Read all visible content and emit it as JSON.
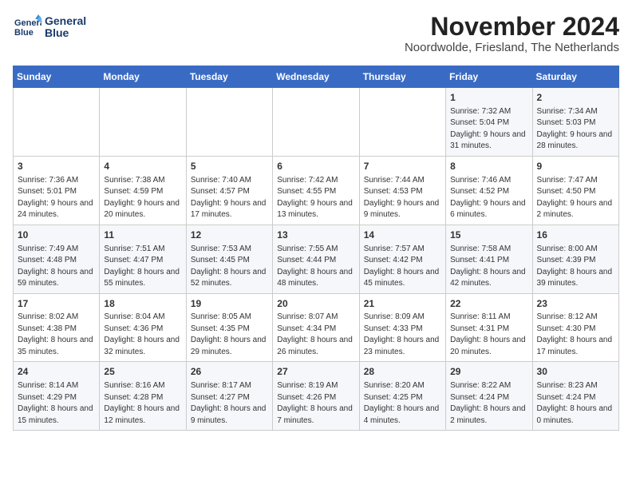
{
  "header": {
    "logo_line1": "General",
    "logo_line2": "Blue",
    "month_title": "November 2024",
    "location": "Noordwolde, Friesland, The Netherlands"
  },
  "weekdays": [
    "Sunday",
    "Monday",
    "Tuesday",
    "Wednesday",
    "Thursday",
    "Friday",
    "Saturday"
  ],
  "weeks": [
    [
      {
        "day": "",
        "info": ""
      },
      {
        "day": "",
        "info": ""
      },
      {
        "day": "",
        "info": ""
      },
      {
        "day": "",
        "info": ""
      },
      {
        "day": "",
        "info": ""
      },
      {
        "day": "1",
        "info": "Sunrise: 7:32 AM\nSunset: 5:04 PM\nDaylight: 9 hours and 31 minutes."
      },
      {
        "day": "2",
        "info": "Sunrise: 7:34 AM\nSunset: 5:03 PM\nDaylight: 9 hours and 28 minutes."
      }
    ],
    [
      {
        "day": "3",
        "info": "Sunrise: 7:36 AM\nSunset: 5:01 PM\nDaylight: 9 hours and 24 minutes."
      },
      {
        "day": "4",
        "info": "Sunrise: 7:38 AM\nSunset: 4:59 PM\nDaylight: 9 hours and 20 minutes."
      },
      {
        "day": "5",
        "info": "Sunrise: 7:40 AM\nSunset: 4:57 PM\nDaylight: 9 hours and 17 minutes."
      },
      {
        "day": "6",
        "info": "Sunrise: 7:42 AM\nSunset: 4:55 PM\nDaylight: 9 hours and 13 minutes."
      },
      {
        "day": "7",
        "info": "Sunrise: 7:44 AM\nSunset: 4:53 PM\nDaylight: 9 hours and 9 minutes."
      },
      {
        "day": "8",
        "info": "Sunrise: 7:46 AM\nSunset: 4:52 PM\nDaylight: 9 hours and 6 minutes."
      },
      {
        "day": "9",
        "info": "Sunrise: 7:47 AM\nSunset: 4:50 PM\nDaylight: 9 hours and 2 minutes."
      }
    ],
    [
      {
        "day": "10",
        "info": "Sunrise: 7:49 AM\nSunset: 4:48 PM\nDaylight: 8 hours and 59 minutes."
      },
      {
        "day": "11",
        "info": "Sunrise: 7:51 AM\nSunset: 4:47 PM\nDaylight: 8 hours and 55 minutes."
      },
      {
        "day": "12",
        "info": "Sunrise: 7:53 AM\nSunset: 4:45 PM\nDaylight: 8 hours and 52 minutes."
      },
      {
        "day": "13",
        "info": "Sunrise: 7:55 AM\nSunset: 4:44 PM\nDaylight: 8 hours and 48 minutes."
      },
      {
        "day": "14",
        "info": "Sunrise: 7:57 AM\nSunset: 4:42 PM\nDaylight: 8 hours and 45 minutes."
      },
      {
        "day": "15",
        "info": "Sunrise: 7:58 AM\nSunset: 4:41 PM\nDaylight: 8 hours and 42 minutes."
      },
      {
        "day": "16",
        "info": "Sunrise: 8:00 AM\nSunset: 4:39 PM\nDaylight: 8 hours and 39 minutes."
      }
    ],
    [
      {
        "day": "17",
        "info": "Sunrise: 8:02 AM\nSunset: 4:38 PM\nDaylight: 8 hours and 35 minutes."
      },
      {
        "day": "18",
        "info": "Sunrise: 8:04 AM\nSunset: 4:36 PM\nDaylight: 8 hours and 32 minutes."
      },
      {
        "day": "19",
        "info": "Sunrise: 8:05 AM\nSunset: 4:35 PM\nDaylight: 8 hours and 29 minutes."
      },
      {
        "day": "20",
        "info": "Sunrise: 8:07 AM\nSunset: 4:34 PM\nDaylight: 8 hours and 26 minutes."
      },
      {
        "day": "21",
        "info": "Sunrise: 8:09 AM\nSunset: 4:33 PM\nDaylight: 8 hours and 23 minutes."
      },
      {
        "day": "22",
        "info": "Sunrise: 8:11 AM\nSunset: 4:31 PM\nDaylight: 8 hours and 20 minutes."
      },
      {
        "day": "23",
        "info": "Sunrise: 8:12 AM\nSunset: 4:30 PM\nDaylight: 8 hours and 17 minutes."
      }
    ],
    [
      {
        "day": "24",
        "info": "Sunrise: 8:14 AM\nSunset: 4:29 PM\nDaylight: 8 hours and 15 minutes."
      },
      {
        "day": "25",
        "info": "Sunrise: 8:16 AM\nSunset: 4:28 PM\nDaylight: 8 hours and 12 minutes."
      },
      {
        "day": "26",
        "info": "Sunrise: 8:17 AM\nSunset: 4:27 PM\nDaylight: 8 hours and 9 minutes."
      },
      {
        "day": "27",
        "info": "Sunrise: 8:19 AM\nSunset: 4:26 PM\nDaylight: 8 hours and 7 minutes."
      },
      {
        "day": "28",
        "info": "Sunrise: 8:20 AM\nSunset: 4:25 PM\nDaylight: 8 hours and 4 minutes."
      },
      {
        "day": "29",
        "info": "Sunrise: 8:22 AM\nSunset: 4:24 PM\nDaylight: 8 hours and 2 minutes."
      },
      {
        "day": "30",
        "info": "Sunrise: 8:23 AM\nSunset: 4:24 PM\nDaylight: 8 hours and 0 minutes."
      }
    ]
  ]
}
